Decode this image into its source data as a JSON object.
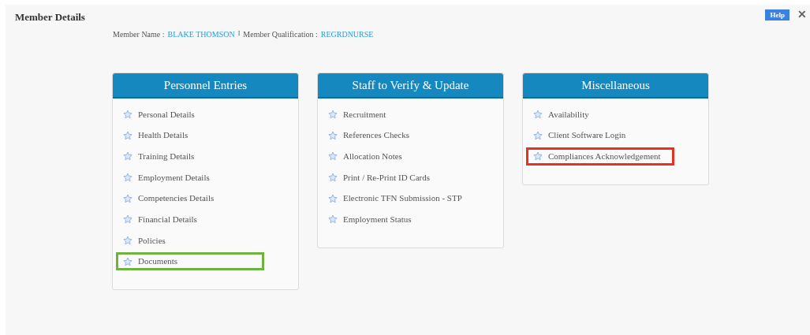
{
  "title": "Member Details",
  "help_button": "Help",
  "close_button": "✕",
  "member_info": {
    "name_label": "Member Name :",
    "name": "BLAKE THOMSON",
    "separator": "I",
    "qualification_label": "Member Qualification :",
    "qualification": "REGRDNURSE"
  },
  "panels": [
    {
      "title": "Personnel Entries",
      "items": [
        {
          "label": "Personal Details"
        },
        {
          "label": "Health Details"
        },
        {
          "label": "Training Details"
        },
        {
          "label": "Employment Details"
        },
        {
          "label": "Competencies Details"
        },
        {
          "label": "Financial Details"
        },
        {
          "label": "Policies"
        },
        {
          "label": "Documents",
          "color": "#6cb33f"
        }
      ]
    },
    {
      "title": "Staff to Verify & Update",
      "items": [
        {
          "label": "Recruitment"
        },
        {
          "label": "References Checks"
        },
        {
          "label": "Allocation Notes"
        },
        {
          "label": "Print / Re-Print ID Cards"
        },
        {
          "label": "Electronic TFN Submission - STP"
        },
        {
          "label": "Employment Status"
        }
      ]
    },
    {
      "title": "Miscellaneous",
      "items": [
        {
          "label": "Availability"
        },
        {
          "label": "Client Software Login"
        },
        {
          "label": "Compliances Acknowledgement",
          "color": "#e8321f"
        }
      ]
    }
  ]
}
